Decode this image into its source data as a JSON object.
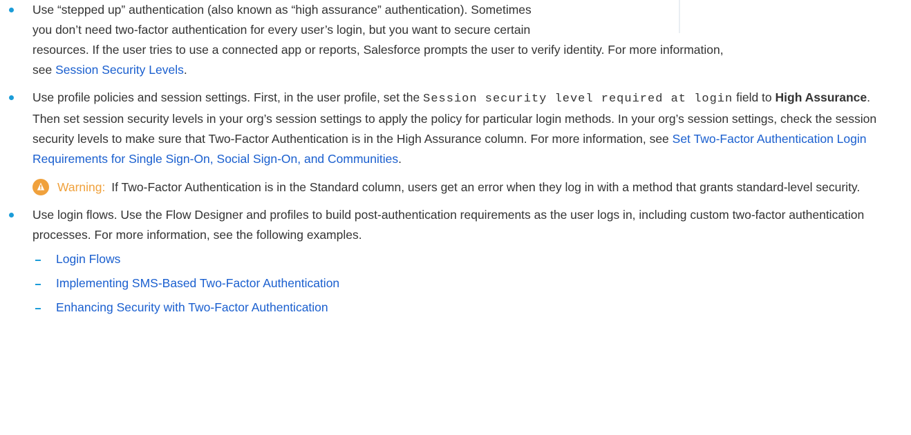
{
  "bullets": {
    "stepped_up": {
      "line1": "Use “stepped up” authentication (also known as “high assurance” authentication). Sometimes",
      "line2": "you don’t need two-factor authentication for every user’s login, but you want to secure certain",
      "line3": "resources. If the user tries to use a connected app or reports, Salesforce prompts the user to verify identity. For more information,",
      "see_prefix": "see ",
      "link": "Session Security Levels",
      "end": "."
    },
    "profile_policies": {
      "text1": "Use profile policies and session settings. First, in the user profile, set the ",
      "code": "Session security level required at login",
      "text2": " field to ",
      "bold": "High Assurance",
      "text3": ". Then set session security levels in your org’s session settings to apply the policy for particular login methods. In your org’s session settings, check the session security levels to make sure that Two-Factor Authentication is in the High Assurance column. For more information, see ",
      "link": "Set Two-Factor Authentication Login Requirements for Single Sign-On, Social Sign-On, and Communities",
      "end": ".",
      "warning": {
        "label": "Warning:",
        "text": "If Two-Factor Authentication is in the Standard column, users get an error when they log in with a method that grants standard-level security."
      }
    },
    "login_flows": {
      "text": "Use login flows. Use the Flow Designer and profiles to build post-authentication requirements as the user logs in, including custom two-factor authentication processes. For more information, see the following examples.",
      "links": [
        "Login Flows",
        "Implementing SMS-Based Two-Factor Authentication",
        "Enhancing Security with Two-Factor Authentication"
      ]
    }
  },
  "colors": {
    "bullet": "#1b9cd8",
    "link": "#1a5fcf",
    "warning": "#f0a13c",
    "text": "#333333"
  }
}
